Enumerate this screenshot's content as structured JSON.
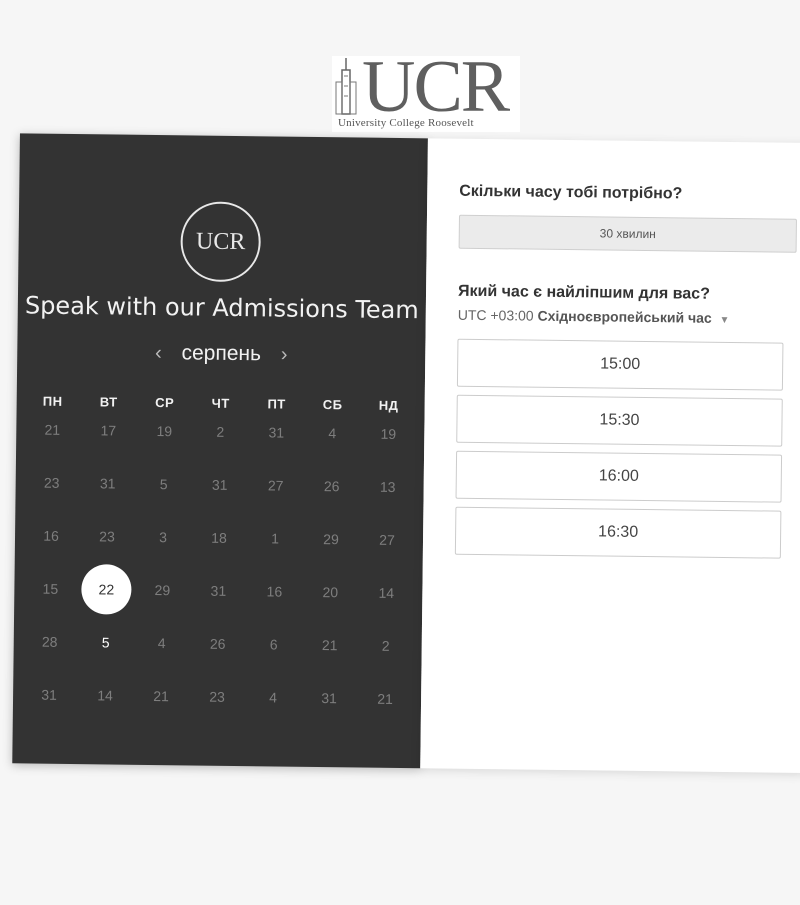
{
  "logo": {
    "mark": "UCR",
    "tagline": "University College Roosevelt"
  },
  "calendar": {
    "badge": "UCR",
    "title": "Speak with our Admissions Team",
    "month": "серпень",
    "weekdays": [
      "ПН",
      "ВТ",
      "СР",
      "ЧТ",
      "ПТ",
      "СБ",
      "НД"
    ],
    "weeks": [
      [
        "21",
        "17",
        "19",
        "2",
        "31",
        "4",
        "19"
      ],
      [
        "23",
        "31",
        "5",
        "31",
        "27",
        "26",
        "13"
      ],
      [
        "16",
        "23",
        "3",
        "18",
        "1",
        "29",
        "27"
      ],
      [
        "15",
        "22",
        "29",
        "31",
        "16",
        "20",
        "14"
      ],
      [
        "28",
        "5",
        "4",
        "26",
        "6",
        "21",
        "2"
      ],
      [
        "31",
        "14",
        "21",
        "23",
        "4",
        "31",
        "21"
      ]
    ],
    "selected_day": "22",
    "available_day": "5"
  },
  "booking": {
    "duration_question": "Скільки часу тобі потрібно?",
    "duration_value": "30 хвилин",
    "time_question": "Який час є найліпшим для вас?",
    "timezone_offset": "UTC +03:00",
    "timezone_name": "Східноєвропейський час",
    "slots": [
      "15:00",
      "15:30",
      "16:00",
      "16:30"
    ]
  },
  "icons": {
    "prev": "chevron-left-icon",
    "next": "chevron-right-icon",
    "dropdown": "caret-down-icon"
  },
  "colors": {
    "calendar_bg": "#333333",
    "panel_bg": "#ffffff",
    "page_bg": "#f6f6f6"
  }
}
